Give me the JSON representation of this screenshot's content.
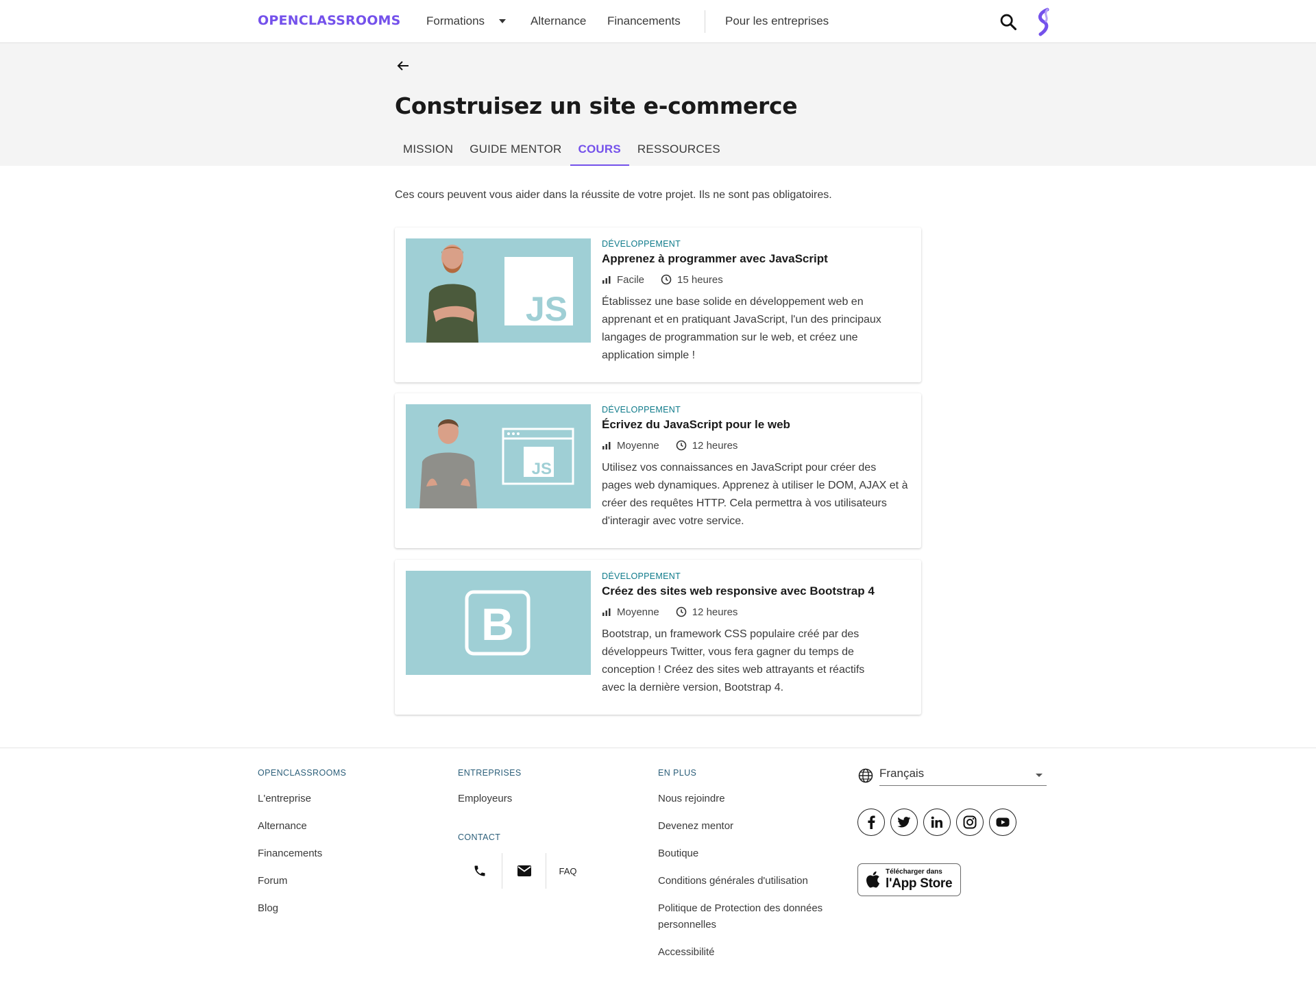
{
  "nav": {
    "logo": "OPENCLASSROOMS",
    "formations": "Formations",
    "alternance": "Alternance",
    "financements": "Financements",
    "entreprises": "Pour les entreprises"
  },
  "header": {
    "title": "Construisez un site e-commerce",
    "tabs": [
      {
        "label": "MISSION",
        "active": false
      },
      {
        "label": "GUIDE MENTOR",
        "active": false
      },
      {
        "label": "COURS",
        "active": true
      },
      {
        "label": "RESSOURCES",
        "active": false
      }
    ]
  },
  "intro": "Ces cours peuvent vous aider dans la réussite de votre projet. Ils ne sont pas obligatoires.",
  "courses": [
    {
      "category": "DÉVELOPPEMENT",
      "title": "Apprenez à programmer avec JavaScript",
      "level": "Facile",
      "duration": "15 heures",
      "description": "Établissez une base solide en développement web en apprenant et en pratiquant JavaScript, l'un des principaux langages de programmation sur le web, et créez une application simple !",
      "thumb_label": "JS"
    },
    {
      "category": "DÉVELOPPEMENT",
      "title": "Écrivez du JavaScript pour le web",
      "level": "Moyenne",
      "duration": "12 heures",
      "description": "Utilisez vos connaissances en JavaScript pour créer des pages web dynamiques. Apprenez à utiliser le DOM, AJAX et à créer des requêtes HTTP. Cela permettra à vos utilisateurs d'interagir avec votre service.",
      "thumb_label": "JS"
    },
    {
      "category": "DÉVELOPPEMENT",
      "title": "Créez des sites web responsive avec Bootstrap 4",
      "level": "Moyenne",
      "duration": "12 heures",
      "description": "Bootstrap, un framework CSS populaire créé par des développeurs Twitter, vous fera gagner du temps de conception ! Créez des sites web attrayants et réactifs avec la dernière version, Bootstrap 4.",
      "thumb_label": "B"
    }
  ],
  "footer": {
    "col1": {
      "heading": "OPENCLASSROOMS",
      "links": [
        "L'entreprise",
        "Alternance",
        "Financements",
        "Forum",
        "Blog"
      ]
    },
    "col2": {
      "heading": "ENTREPRISES",
      "links": [
        "Employeurs"
      ],
      "contact_heading": "CONTACT",
      "faq": "FAQ"
    },
    "col3": {
      "heading": "EN PLUS",
      "links": [
        "Nous rejoindre",
        "Devenez mentor",
        "Boutique",
        "Conditions générales d'utilisation",
        "Politique de Protection des données",
        "personnelles",
        "Accessibilité"
      ]
    },
    "language": "Français",
    "appstore_small": "Télécharger dans",
    "appstore_big": "l'App Store"
  },
  "colors": {
    "brand": "#7451eb",
    "category": "#0e7a8a",
    "thumb_bg": "#9fcfd5"
  }
}
